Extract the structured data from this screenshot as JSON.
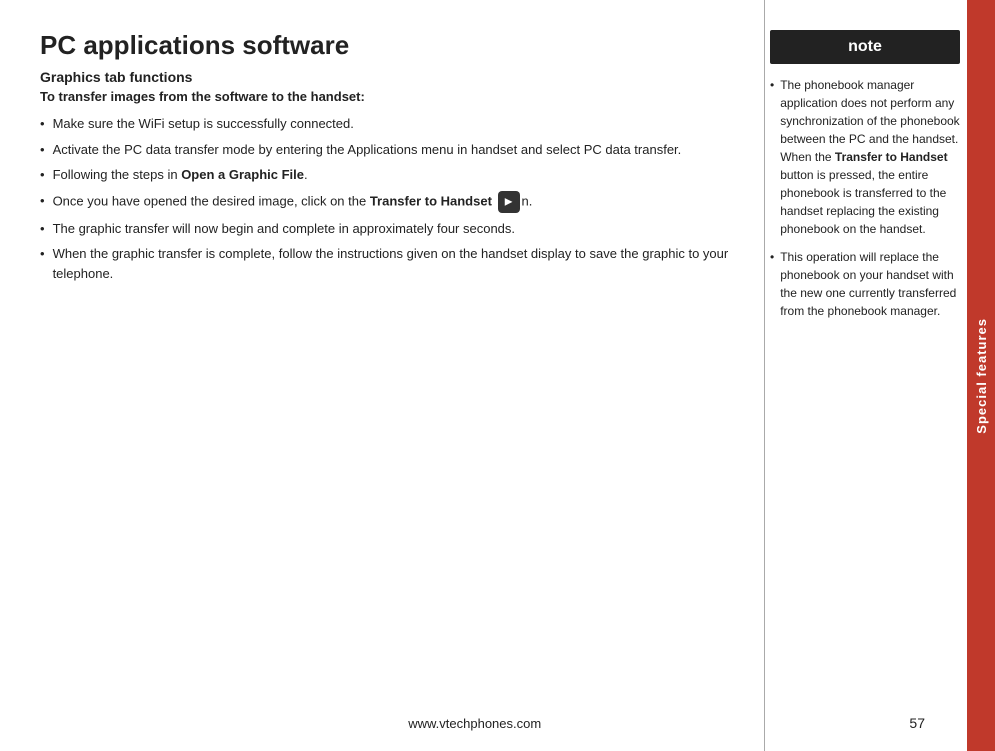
{
  "page": {
    "title": "PC applications software",
    "section": "Graphics tab functions",
    "subtitle": "To transfer images from the software to the handset:",
    "bullets": [
      {
        "id": 1,
        "text": "Make sure the WiFi setup is successfully connected."
      },
      {
        "id": 2,
        "text": "Activate the PC data transfer mode by entering the Applications menu in handset and select PC data transfer."
      },
      {
        "id": 3,
        "prefix": "Following the steps in ",
        "bold": "Open a Graphic File",
        "suffix": "."
      },
      {
        "id": 4,
        "prefix": "Once you have opened the desired image, click on the ",
        "bold": "Transfer to Handset",
        "hasIcon": true,
        "suffix": "n."
      },
      {
        "id": 5,
        "text": "The graphic transfer will now begin and complete in approximately four seconds."
      },
      {
        "id": 6,
        "text": "When the graphic transfer is complete, follow the instructions given on the handset display to save the graphic to your telephone."
      }
    ],
    "note": {
      "header": "note",
      "items": [
        {
          "id": 1,
          "text": "The phonebook manager application does not perform any synchronization of the phonebook between the PC and the handset. When the ",
          "bold": "Transfer to Handset",
          "suffix": " button is pressed, the entire phonebook is transferred to the handset replacing the existing phonebook on the handset."
        },
        {
          "id": 2,
          "text": "This operation will replace the phonebook on your handset with the new one currently transferred from the phonebook manager."
        }
      ]
    },
    "footer": {
      "url": "www.vtechphones.com",
      "pageNumber": "57"
    },
    "sidebar": {
      "label": "Special features"
    }
  }
}
